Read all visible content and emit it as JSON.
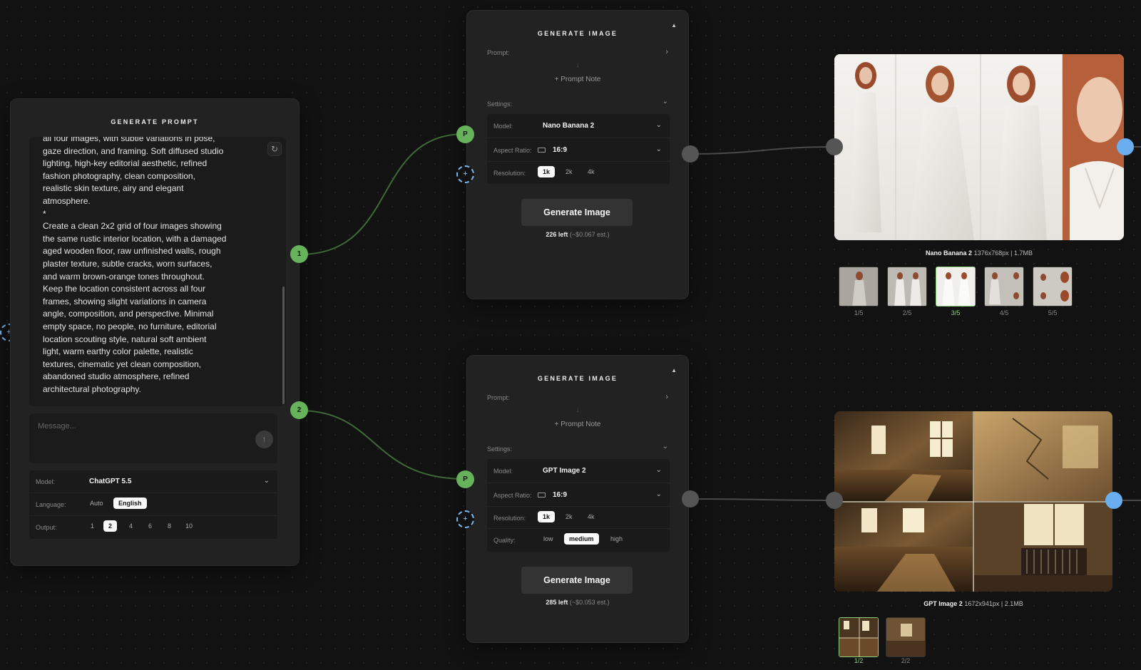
{
  "prompt_node": {
    "title": "GENERATE PROMPT",
    "text": "all four images, with subtle variations in pose,\ngaze direction, and framing. Soft diffused studio\nlighting, high-key editorial aesthetic, refined\nfashion photography, clean composition,\nrealistic skin texture, airy and elegant\natmosphere.\n*\nCreate a clean 2x2 grid of four images showing\nthe same rustic interior location, with a damaged\naged wooden floor, raw unfinished walls, rough\nplaster texture, subtle cracks, worn surfaces,\nand warm brown-orange tones throughout.\nKeep the location consistent across all four\nframes, showing slight variations in camera\nangle, composition, and perspective. Minimal\nempty space, no people, no furniture, editorial\nlocation scouting style, natural soft ambient\nlight, warm earthy color palette, realistic\ntextures, cinematic yet clean composition,\nabandoned studio atmosphere, refined\narchitectural photography.",
    "reset_icon": "refresh-icon",
    "message_placeholder": "Message...",
    "send_icon": "arrow-up-icon",
    "model_label": "Model:",
    "model_value": "ChatGPT 5.5",
    "language_label": "Language:",
    "language_options": [
      "Auto",
      "English"
    ],
    "language_selected": "English",
    "output_label": "Output:",
    "output_options": [
      "1",
      "2",
      "4",
      "6",
      "8",
      "10"
    ],
    "output_selected": "2",
    "out_handles": [
      "1",
      "2"
    ]
  },
  "gen_nodes": [
    {
      "title": "GENERATE IMAGE",
      "prompt_label": "Prompt:",
      "arrow_glyph": "↓",
      "prompt_note": "+ Prompt Note",
      "settings_label": "Settings:",
      "model_label": "Model:",
      "model_value": "Nano Banana 2",
      "aspect_label": "Aspect Ratio:",
      "aspect_value": "16:9",
      "resolution_label": "Resolution:",
      "resolution_options": [
        "1k",
        "2k",
        "4k"
      ],
      "resolution_selected": "1k",
      "button": "Generate Image",
      "left_count": "226",
      "left_word": "left",
      "est": "(~$0.067 est.)",
      "in_handle": "P"
    },
    {
      "title": "GENERATE IMAGE",
      "prompt_label": "Prompt:",
      "arrow_glyph": "↓",
      "prompt_note": "+ Prompt Note",
      "settings_label": "Settings:",
      "model_label": "Model:",
      "model_value": "GPT Image 2",
      "aspect_label": "Aspect Ratio:",
      "aspect_value": "16:9",
      "resolution_label": "Resolution:",
      "resolution_options": [
        "1k",
        "2k",
        "4k"
      ],
      "resolution_selected": "1k",
      "quality_label": "Quality:",
      "quality_options": [
        "low",
        "medium",
        "high"
      ],
      "quality_selected": "medium",
      "button": "Generate Image",
      "left_count": "285",
      "left_word": "left",
      "est": "(~$0.053 est.)",
      "in_handle": "P"
    }
  ],
  "outputs": [
    {
      "model": "Nano Banana 2",
      "meta": "1376x768px | 1.7MB",
      "thumbs": [
        "1/5",
        "2/5",
        "3/5",
        "4/5",
        "5/5"
      ],
      "current": "3/5"
    },
    {
      "model": "GPT Image 2",
      "meta": "1672x941px | 2.1MB",
      "thumbs": [
        "1/2",
        "2/2"
      ],
      "current": "1/2"
    }
  ],
  "colors": {
    "canvas": "#121212",
    "node": "#222222",
    "handle_green": "#67b35c",
    "handle_blue": "#6aaef0",
    "wire": "#3f6a38"
  }
}
